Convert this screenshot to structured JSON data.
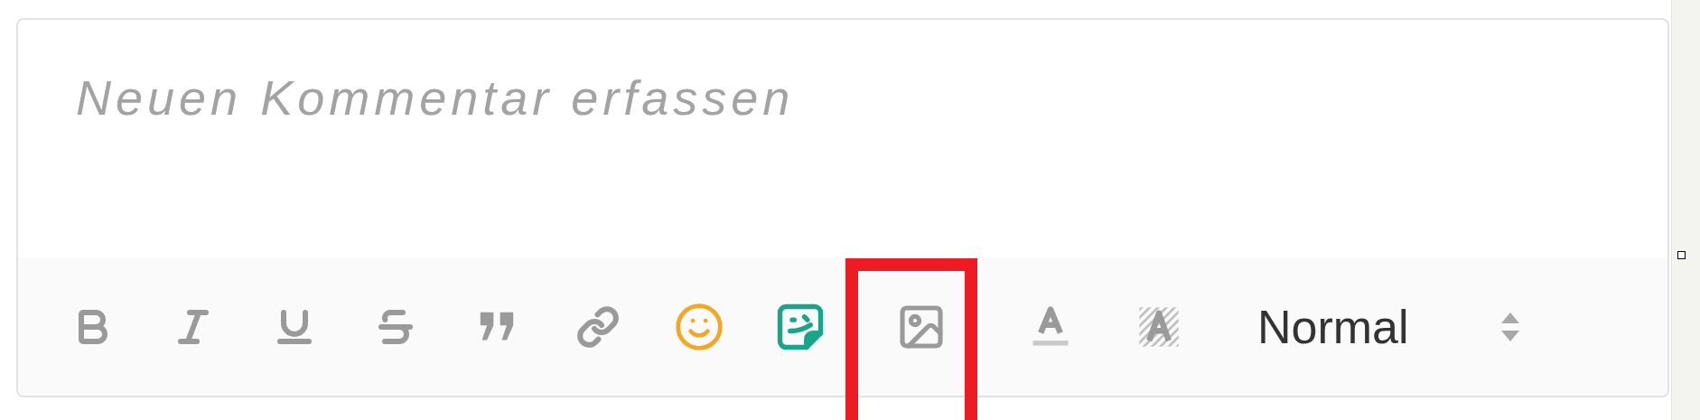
{
  "editor": {
    "placeholder": "Neuen Kommentar erfassen"
  },
  "toolbar": {
    "tools": [
      {
        "kind": "bold",
        "highlighted": false
      },
      {
        "kind": "italic",
        "highlighted": false
      },
      {
        "kind": "underline",
        "highlighted": false
      },
      {
        "kind": "strike",
        "highlighted": false
      },
      {
        "kind": "quote",
        "highlighted": false
      },
      {
        "kind": "link",
        "highlighted": false
      },
      {
        "kind": "emoji",
        "highlighted": false
      },
      {
        "kind": "sticker",
        "highlighted": false
      },
      {
        "kind": "image",
        "highlighted": true
      },
      {
        "kind": "color",
        "highlighted": false
      },
      {
        "kind": "background",
        "highlighted": false
      }
    ],
    "format_select": {
      "value": "Normal"
    }
  }
}
